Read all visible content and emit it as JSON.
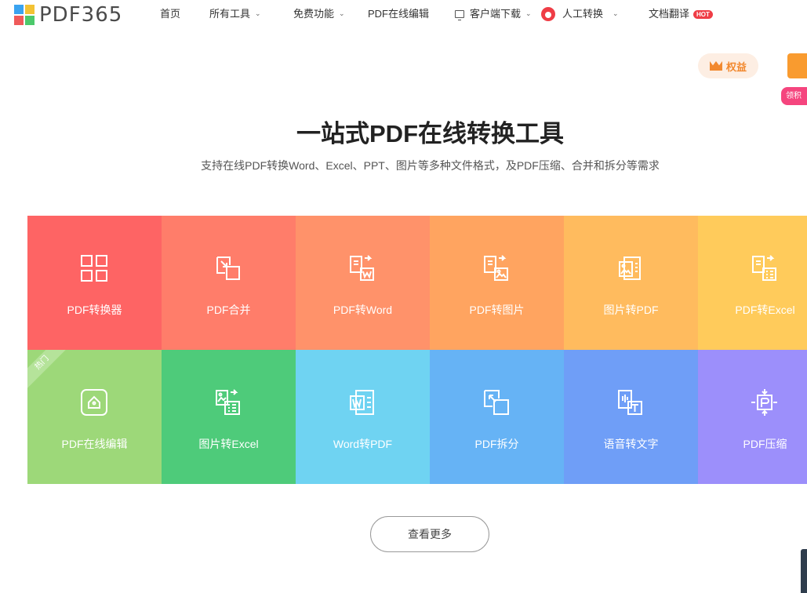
{
  "header": {
    "logo_text": "PDF365",
    "nav": [
      {
        "label": "首页",
        "caret": false
      },
      {
        "label": "所有工具",
        "caret": true
      },
      {
        "label": "免费功能",
        "caret": true
      },
      {
        "label": "PDF在线编辑",
        "caret": false
      },
      {
        "label": "客户端下载",
        "caret": true
      },
      {
        "label": "人工转换",
        "caret": true
      },
      {
        "label": "文档翻译",
        "caret": false
      }
    ],
    "hot_badge": "HOT"
  },
  "side": {
    "quanyi_label": "权益",
    "pink_label": "领积"
  },
  "hero": {
    "title": "一站式PDF在线转换工具",
    "subtitle": "支持在线PDF转换Word、Excel、PPT、图片等多种文件格式，及PDF压缩、合并和拆分等需求"
  },
  "tiles": [
    {
      "label": "PDF转换器",
      "color": "#fe6464",
      "icon": "grid-icon"
    },
    {
      "label": "PDF合并",
      "color": "#ff7d6a",
      "icon": "merge-icon"
    },
    {
      "label": "PDF转Word",
      "color": "#ff926a",
      "icon": "pdf-to-word-icon"
    },
    {
      "label": "PDF转图片",
      "color": "#ffa460",
      "icon": "pdf-to-image-icon"
    },
    {
      "label": "图片转PDF",
      "color": "#ffbb5e",
      "icon": "image-to-pdf-icon"
    },
    {
      "label": "PDF转Excel",
      "color": "#ffcb5b",
      "icon": "pdf-to-excel-icon"
    },
    {
      "label": "PDF在线编辑",
      "color": "#9dd879",
      "icon": "edit-icon",
      "ribbon": "热门"
    },
    {
      "label": "图片转Excel",
      "color": "#4ecb7a",
      "icon": "image-to-excel-icon"
    },
    {
      "label": "Word转PDF",
      "color": "#6fd3f2",
      "icon": "word-to-pdf-icon"
    },
    {
      "label": "PDF拆分",
      "color": "#66b3f5",
      "icon": "split-icon"
    },
    {
      "label": "语音转文字",
      "color": "#6f9ef7",
      "icon": "voice-to-text-icon"
    },
    {
      "label": "PDF压缩",
      "color": "#9c8ffb",
      "icon": "compress-icon"
    }
  ],
  "more_button": "查看更多"
}
